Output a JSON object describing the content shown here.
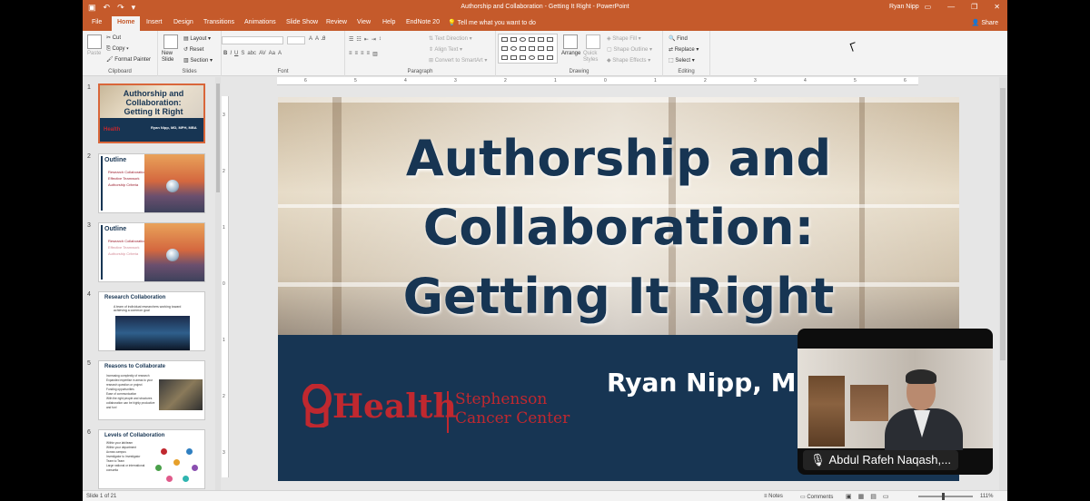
{
  "window": {
    "title": "Authorship and Collaboration - Getting It Right - PowerPoint",
    "user": "Ryan Nipp"
  },
  "ribbon_tabs": [
    "File",
    "Home",
    "Insert",
    "Design",
    "Transitions",
    "Animations",
    "Slide Show",
    "Review",
    "View",
    "Help",
    "EndNote 20"
  ],
  "active_tab": "Home",
  "tell_me": "Tell me what you want to do",
  "share": "Share",
  "ribbon": {
    "clipboard": {
      "paste": "Paste",
      "cut": "Cut",
      "copy": "Copy",
      "format_painter": "Format Painter",
      "label": "Clipboard"
    },
    "slides": {
      "new_slide": "New Slide",
      "layout": "Layout",
      "reset": "Reset",
      "section": "Section",
      "label": "Slides"
    },
    "font": {
      "label": "Font"
    },
    "paragraph": {
      "text_direction": "Text Direction",
      "align_text": "Align Text",
      "smartart": "Convert to SmartArt",
      "label": "Paragraph"
    },
    "drawing": {
      "arrange": "Arrange",
      "quick_styles": "Quick Styles",
      "shape_fill": "Shape Fill",
      "shape_outline": "Shape Outline",
      "shape_effects": "Shape Effects",
      "label": "Drawing"
    },
    "editing": {
      "find": "Find",
      "replace": "Replace",
      "select": "Select",
      "label": "Editing"
    }
  },
  "thumbnails": [
    {
      "num": "1",
      "title": "Authorship and Collaboration: Getting It Right",
      "subtitle": "Ryan Nipp, MD, MPH, MBA"
    },
    {
      "num": "2",
      "title": "Outline",
      "items": [
        "Research Collaboration",
        "Effective Teamwork",
        "Authorship Criteria"
      ]
    },
    {
      "num": "3",
      "title": "Outline",
      "items": [
        "Research Collaboration",
        "Effective Teamwork",
        "Authorship Criteria"
      ]
    },
    {
      "num": "4",
      "title": "Research Collaboration",
      "text": "A team of individual researchers working toward achieving a common goal"
    },
    {
      "num": "5",
      "title": "Reasons to Collaborate",
      "items": [
        "Increasing complexity of research",
        "Expanded expertise in areas to your research question or project",
        "Funding opportunities",
        "Ease of communication",
        "With the right people and structures collaboration can be highly productive and fun!"
      ]
    },
    {
      "num": "6",
      "title": "Levels of Collaboration",
      "items": [
        "Within your lab/team",
        "Within your department",
        "Across campus",
        "Investigator to Investigator",
        "Team to Team",
        "Large national or international consortia"
      ]
    }
  ],
  "slide": {
    "title": "Authorship and Collaboration: Getting It Right",
    "presenter": "Ryan Nipp, MD,",
    "logo_word": "Health",
    "center_line1": "Stephenson",
    "center_line2": "Cancer Center"
  },
  "ruler": {
    "h_ticks": [
      "6",
      "5",
      "4",
      "3",
      "2",
      "1",
      "0",
      "1",
      "2",
      "3",
      "4",
      "5",
      "6"
    ],
    "v_ticks": [
      "3",
      "2",
      "1",
      "0",
      "1",
      "2",
      "3"
    ]
  },
  "video": {
    "participant": "Abdul Rafeh Naqash,..."
  },
  "status": {
    "slide_info": "Slide 1 of 21",
    "notes": "Notes",
    "comments": "Comments",
    "zoom": "111%"
  },
  "colors": {
    "accent": "#c55a2b",
    "navy": "#173553",
    "ou_red": "#c0282f"
  }
}
